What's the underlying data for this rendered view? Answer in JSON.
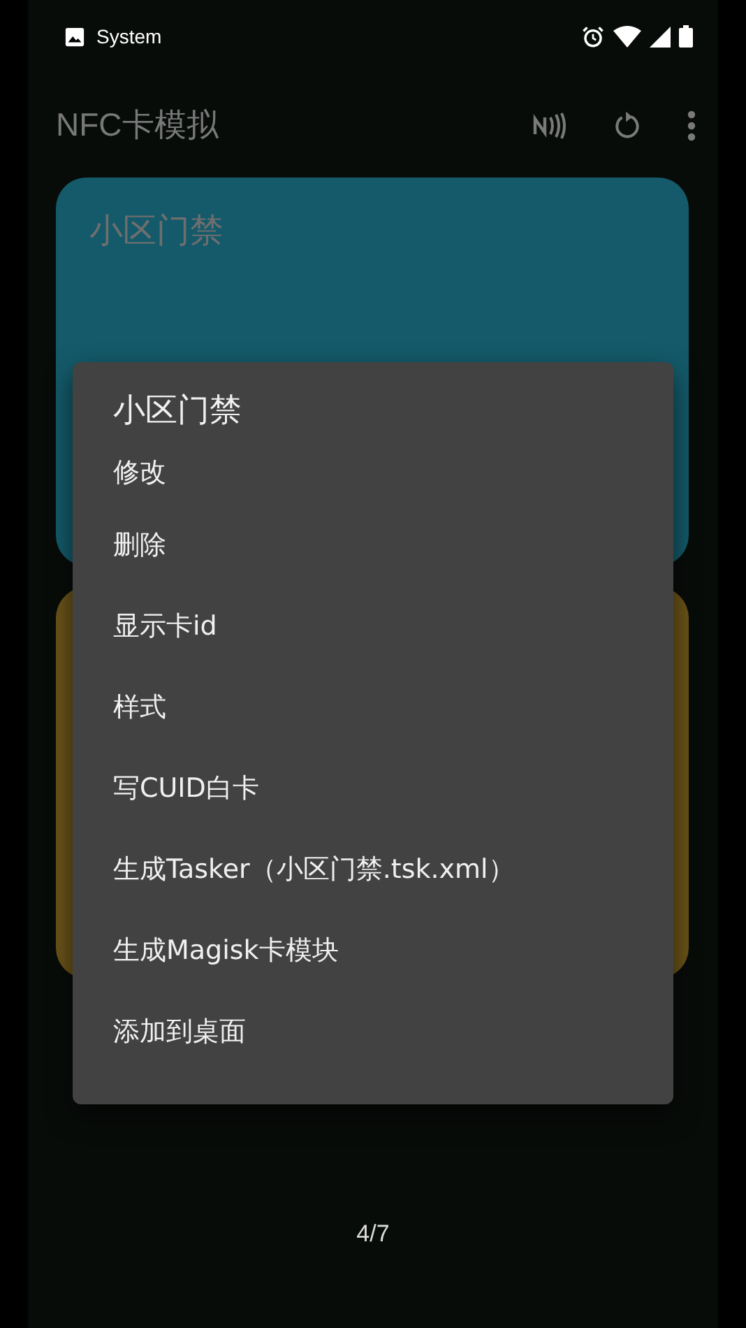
{
  "status_bar": {
    "app_label": "System"
  },
  "toolbar": {
    "title": "NFC卡模拟"
  },
  "cards": [
    {
      "title": "小区门禁",
      "color": "#145a6a"
    },
    {
      "color": "#6b5419"
    }
  ],
  "menu": {
    "title": "小区门禁",
    "items": [
      "修改",
      "删除",
      "显示卡id",
      "样式",
      "写CUID白卡",
      "生成Tasker（小区门禁.tsk.xml）",
      "生成Magisk卡模块",
      "添加到桌面"
    ]
  },
  "page_indicator": "4/7"
}
